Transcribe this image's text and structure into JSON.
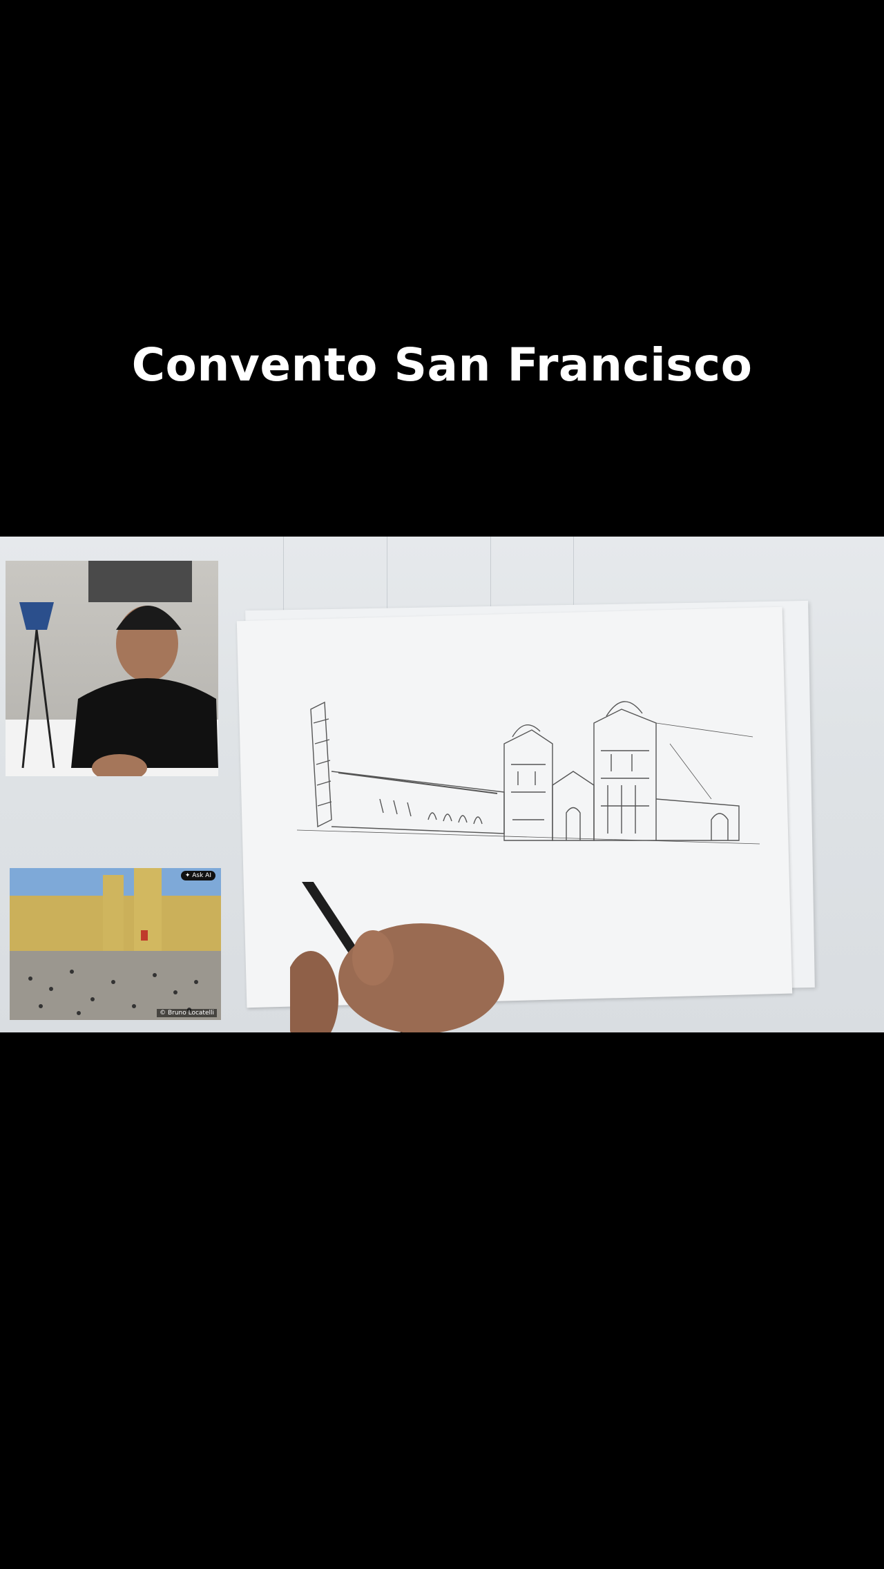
{
  "video": {
    "title": "Convento San Francisco"
  },
  "photo_overlay": {
    "ask_label": "Ask AI",
    "credit": "© Bruno Locatelli"
  },
  "colors": {
    "background": "#000000",
    "title_text": "#ffffff"
  },
  "icons": {
    "ask_ai": "sparkle-icon"
  }
}
